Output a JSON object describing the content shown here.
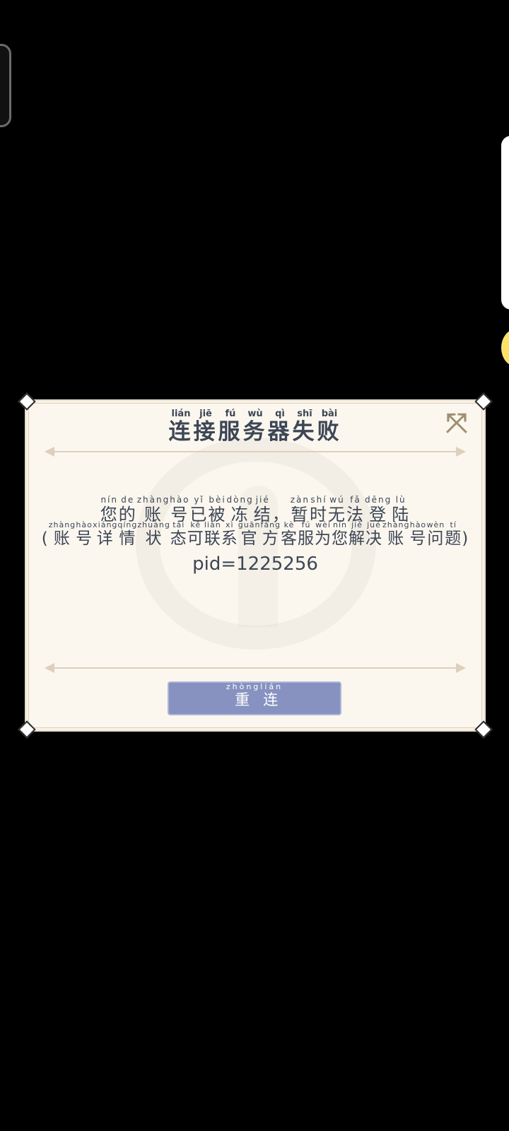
{
  "dialog": {
    "title": [
      {
        "char": "连",
        "py": "lián"
      },
      {
        "char": "接",
        "py": "jiē"
      },
      {
        "char": "服",
        "py": "fú"
      },
      {
        "char": "务",
        "py": "wù"
      },
      {
        "char": "器",
        "py": "qì"
      },
      {
        "char": "失",
        "py": "shī"
      },
      {
        "char": "败",
        "py": "bài"
      }
    ],
    "message_line1": [
      {
        "char": "您",
        "py": "nín"
      },
      {
        "char": "的",
        "py": "de"
      },
      {
        "char": "账",
        "py": "zhàng"
      },
      {
        "char": "号",
        "py": "hào"
      },
      {
        "char": "已",
        "py": "yǐ"
      },
      {
        "char": "被",
        "py": "bèi"
      },
      {
        "char": "冻",
        "py": "dòng"
      },
      {
        "char": "结",
        "py": "jié"
      },
      {
        "char": "，",
        "py": ""
      },
      {
        "char": "暂",
        "py": "zàn"
      },
      {
        "char": "时",
        "py": "shí"
      },
      {
        "char": "无",
        "py": "wú"
      },
      {
        "char": "法",
        "py": "fǎ"
      },
      {
        "char": "登",
        "py": "dēng"
      },
      {
        "char": "陆",
        "py": "lù"
      }
    ],
    "message_line2": [
      {
        "char": "(",
        "py": ""
      },
      {
        "char": "账",
        "py": "zhàng"
      },
      {
        "char": "号",
        "py": "hào"
      },
      {
        "char": "详",
        "py": "xiáng"
      },
      {
        "char": "情",
        "py": "qíng"
      },
      {
        "char": "状",
        "py": "zhuàng"
      },
      {
        "char": "态",
        "py": "tài"
      },
      {
        "char": "可",
        "py": "kě"
      },
      {
        "char": "联",
        "py": "lián"
      },
      {
        "char": "系",
        "py": "xì"
      },
      {
        "char": "官",
        "py": "guān"
      },
      {
        "char": "方",
        "py": "fāng"
      },
      {
        "char": "客",
        "py": "kè"
      },
      {
        "char": "服",
        "py": "fú"
      },
      {
        "char": "为",
        "py": "wèi"
      },
      {
        "char": "您",
        "py": "nín"
      },
      {
        "char": "解",
        "py": "jiě"
      },
      {
        "char": "决",
        "py": "jué"
      },
      {
        "char": "账",
        "py": "zhàng"
      },
      {
        "char": "号",
        "py": "hào"
      },
      {
        "char": "问",
        "py": "wèn"
      },
      {
        "char": "题",
        "py": "tí"
      },
      {
        "char": ")",
        "py": ""
      }
    ],
    "pid": "pid=1225256",
    "reconnect_button": [
      {
        "char": "重",
        "py": "zhòng"
      },
      {
        "char": "连",
        "py": "lián"
      }
    ],
    "close_icon": "close-icon"
  },
  "colors": {
    "text": "#3d4655",
    "dialog_bg": "#fbf7ef",
    "button_bg": "#8792c1",
    "close_icon": "#a08f72"
  }
}
